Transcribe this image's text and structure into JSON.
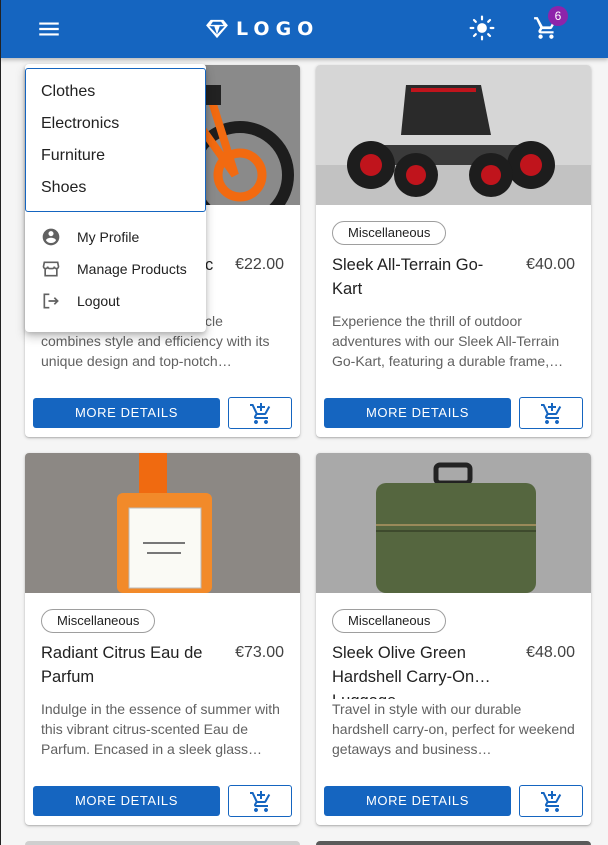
{
  "header": {
    "logo_text": "LOGO",
    "cart_count": "6",
    "brand_color": "#1565c0",
    "badge_color": "#8e24aa"
  },
  "menu": {
    "categories": [
      "Clothes",
      "Electronics",
      "Furniture",
      "Shoes"
    ],
    "account": [
      {
        "label": "My Profile",
        "icon": "account-circle-icon"
      },
      {
        "label": "Manage Products",
        "icon": "store-icon"
      },
      {
        "label": "Logout",
        "icon": "logout-icon"
      }
    ]
  },
  "products": [
    {
      "title_visible": "c",
      "price": "€22.00",
      "desc_visible_line1": "cle",
      "desc_rest": "combines style and efficiency with its unique design and top-notch…",
      "more_label": "MORE DETAILS"
    },
    {
      "category": "Miscellaneous",
      "title": "Sleek All-Terrain Go-Kart",
      "price": "€40.00",
      "desc": "Experience the thrill of outdoor adventures with our Sleek All-Terrain Go-Kart, featuring a durable frame,…",
      "more_label": "MORE DETAILS"
    },
    {
      "category": "Miscellaneous",
      "title": "Radiant Citrus Eau de Parfum",
      "price": "€73.00",
      "desc": "Indulge in the essence of summer with this vibrant citrus-scented Eau de Parfum. Encased in a sleek glass…",
      "more_label": "MORE DETAILS"
    },
    {
      "category": "Miscellaneous",
      "title": "Sleek Olive Green Hardshell Carry-On…",
      "title_overflow": "Luggage",
      "price": "€48.00",
      "desc": "Travel in style with our durable hardshell carry-on, perfect for weekend getaways and business…",
      "more_label": "MORE DETAILS"
    }
  ]
}
